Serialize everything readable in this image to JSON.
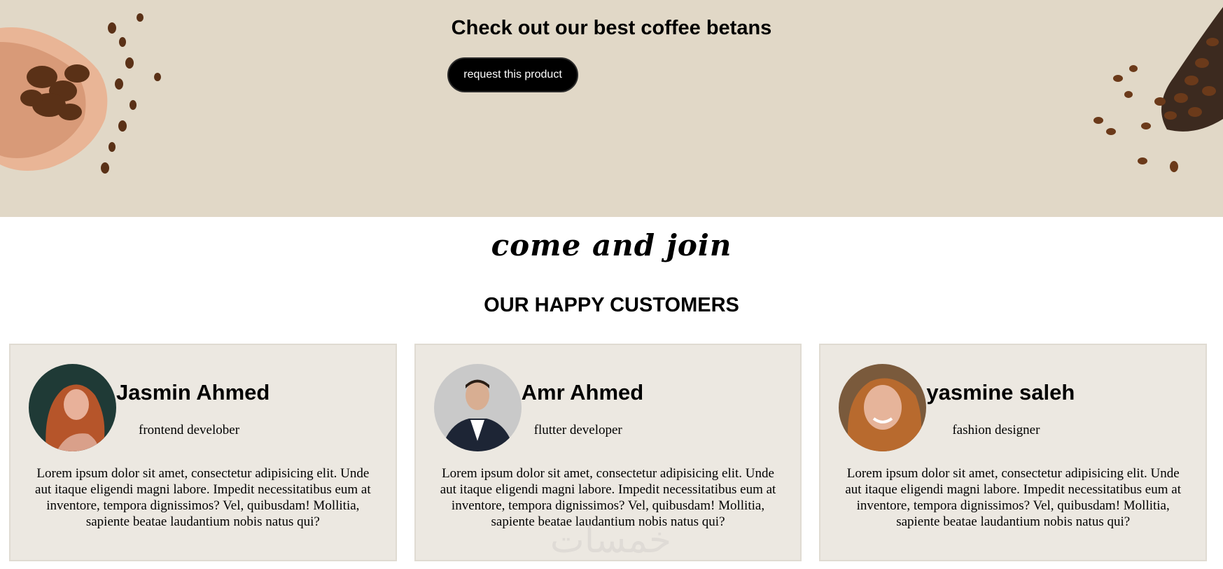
{
  "hero": {
    "title": "Check out our best coffee betans",
    "button_label": "request this product",
    "background": "#e1d8c7"
  },
  "join_heading": "come and join",
  "customers": {
    "heading": "OUR HAPPY CUSTOMERS",
    "cards": [
      {
        "name": "Jasmin Ahmed",
        "role": "frontend develober",
        "text": "Lorem ipsum dolor sit amet, consectetur adipisicing elit. Unde aut itaque eligendi magni labore. Impedit necessitatibus eum at inventore, tempora dignissimos? Vel, quibusdam! Mollitia, sapiente beatae laudantium nobis natus qui?"
      },
      {
        "name": "Amr Ahmed",
        "role": "flutter developer",
        "text": "Lorem ipsum dolor sit amet, consectetur adipisicing elit. Unde aut itaque eligendi magni labore. Impedit necessitatibus eum at inventore, tempora dignissimos? Vel, quibusdam! Mollitia, sapiente beatae laudantium nobis natus qui?"
      },
      {
        "name": "yasmine saleh",
        "role": "fashion designer",
        "text": "Lorem ipsum dolor sit amet, consectetur adipisicing elit. Unde aut itaque eligendi magni labore. Impedit necessitatibus eum at inventore, tempora dignissimos? Vel, quibusdam! Mollitia, sapiente beatae laudantium nobis natus qui?"
      }
    ]
  },
  "watermark": "خمسات"
}
